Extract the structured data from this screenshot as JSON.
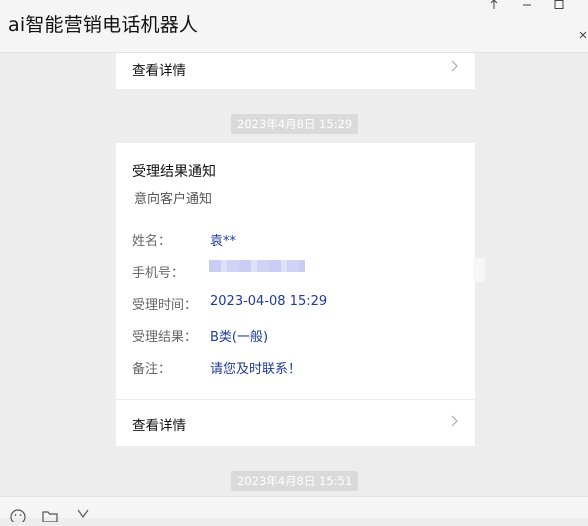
{
  "window": {
    "title": "ai智能营销电话机器人"
  },
  "messages": {
    "card_top": {
      "detail_label": "查看详情"
    },
    "timestamp_1": "2023年4月8日  15:29",
    "card_main": {
      "title": "受理结果通知",
      "subtitle": "意向客户通知",
      "fields": [
        {
          "key": "姓名：",
          "value": "袁**"
        },
        {
          "key": "手机号：",
          "value": ""
        },
        {
          "key": "受理时间：",
          "value": "2023-04-08 15:29"
        },
        {
          "key": "受理结果：",
          "value": "B类(一般)"
        },
        {
          "key": "备注：",
          "value": "请您及时联系！"
        }
      ],
      "detail_label": "查看详情"
    },
    "timestamp_2": "2023年4月8日  15:51"
  },
  "toolbar": {
    "icons": [
      "emoji-icon",
      "folder-icon",
      "scissors-icon"
    ]
  }
}
